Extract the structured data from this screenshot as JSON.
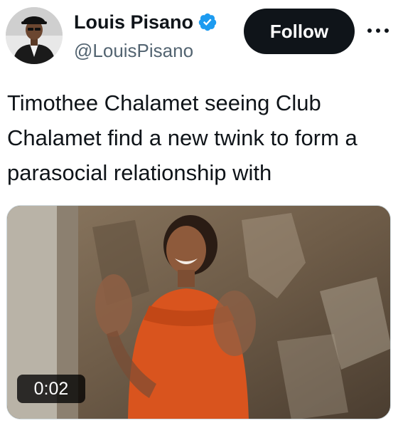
{
  "author": {
    "display_name": "Louis Pisano",
    "handle": "@LouisPisano",
    "avatar_icon": "avatar",
    "verified_icon": "verified-badge-icon",
    "verified_color": "#1d9bf0"
  },
  "actions": {
    "follow_label": "Follow",
    "more_icon": "more-options-icon"
  },
  "tweet": {
    "text": "Timothee Chalamet seeing Club Chalamet find a new twink to form a parasocial relationship with"
  },
  "media": {
    "type": "video",
    "duration": "0:02"
  },
  "colors": {
    "text_primary": "#0f1419",
    "text_secondary": "#536471",
    "follow_bg": "#0f1419",
    "follow_text": "#ffffff"
  }
}
